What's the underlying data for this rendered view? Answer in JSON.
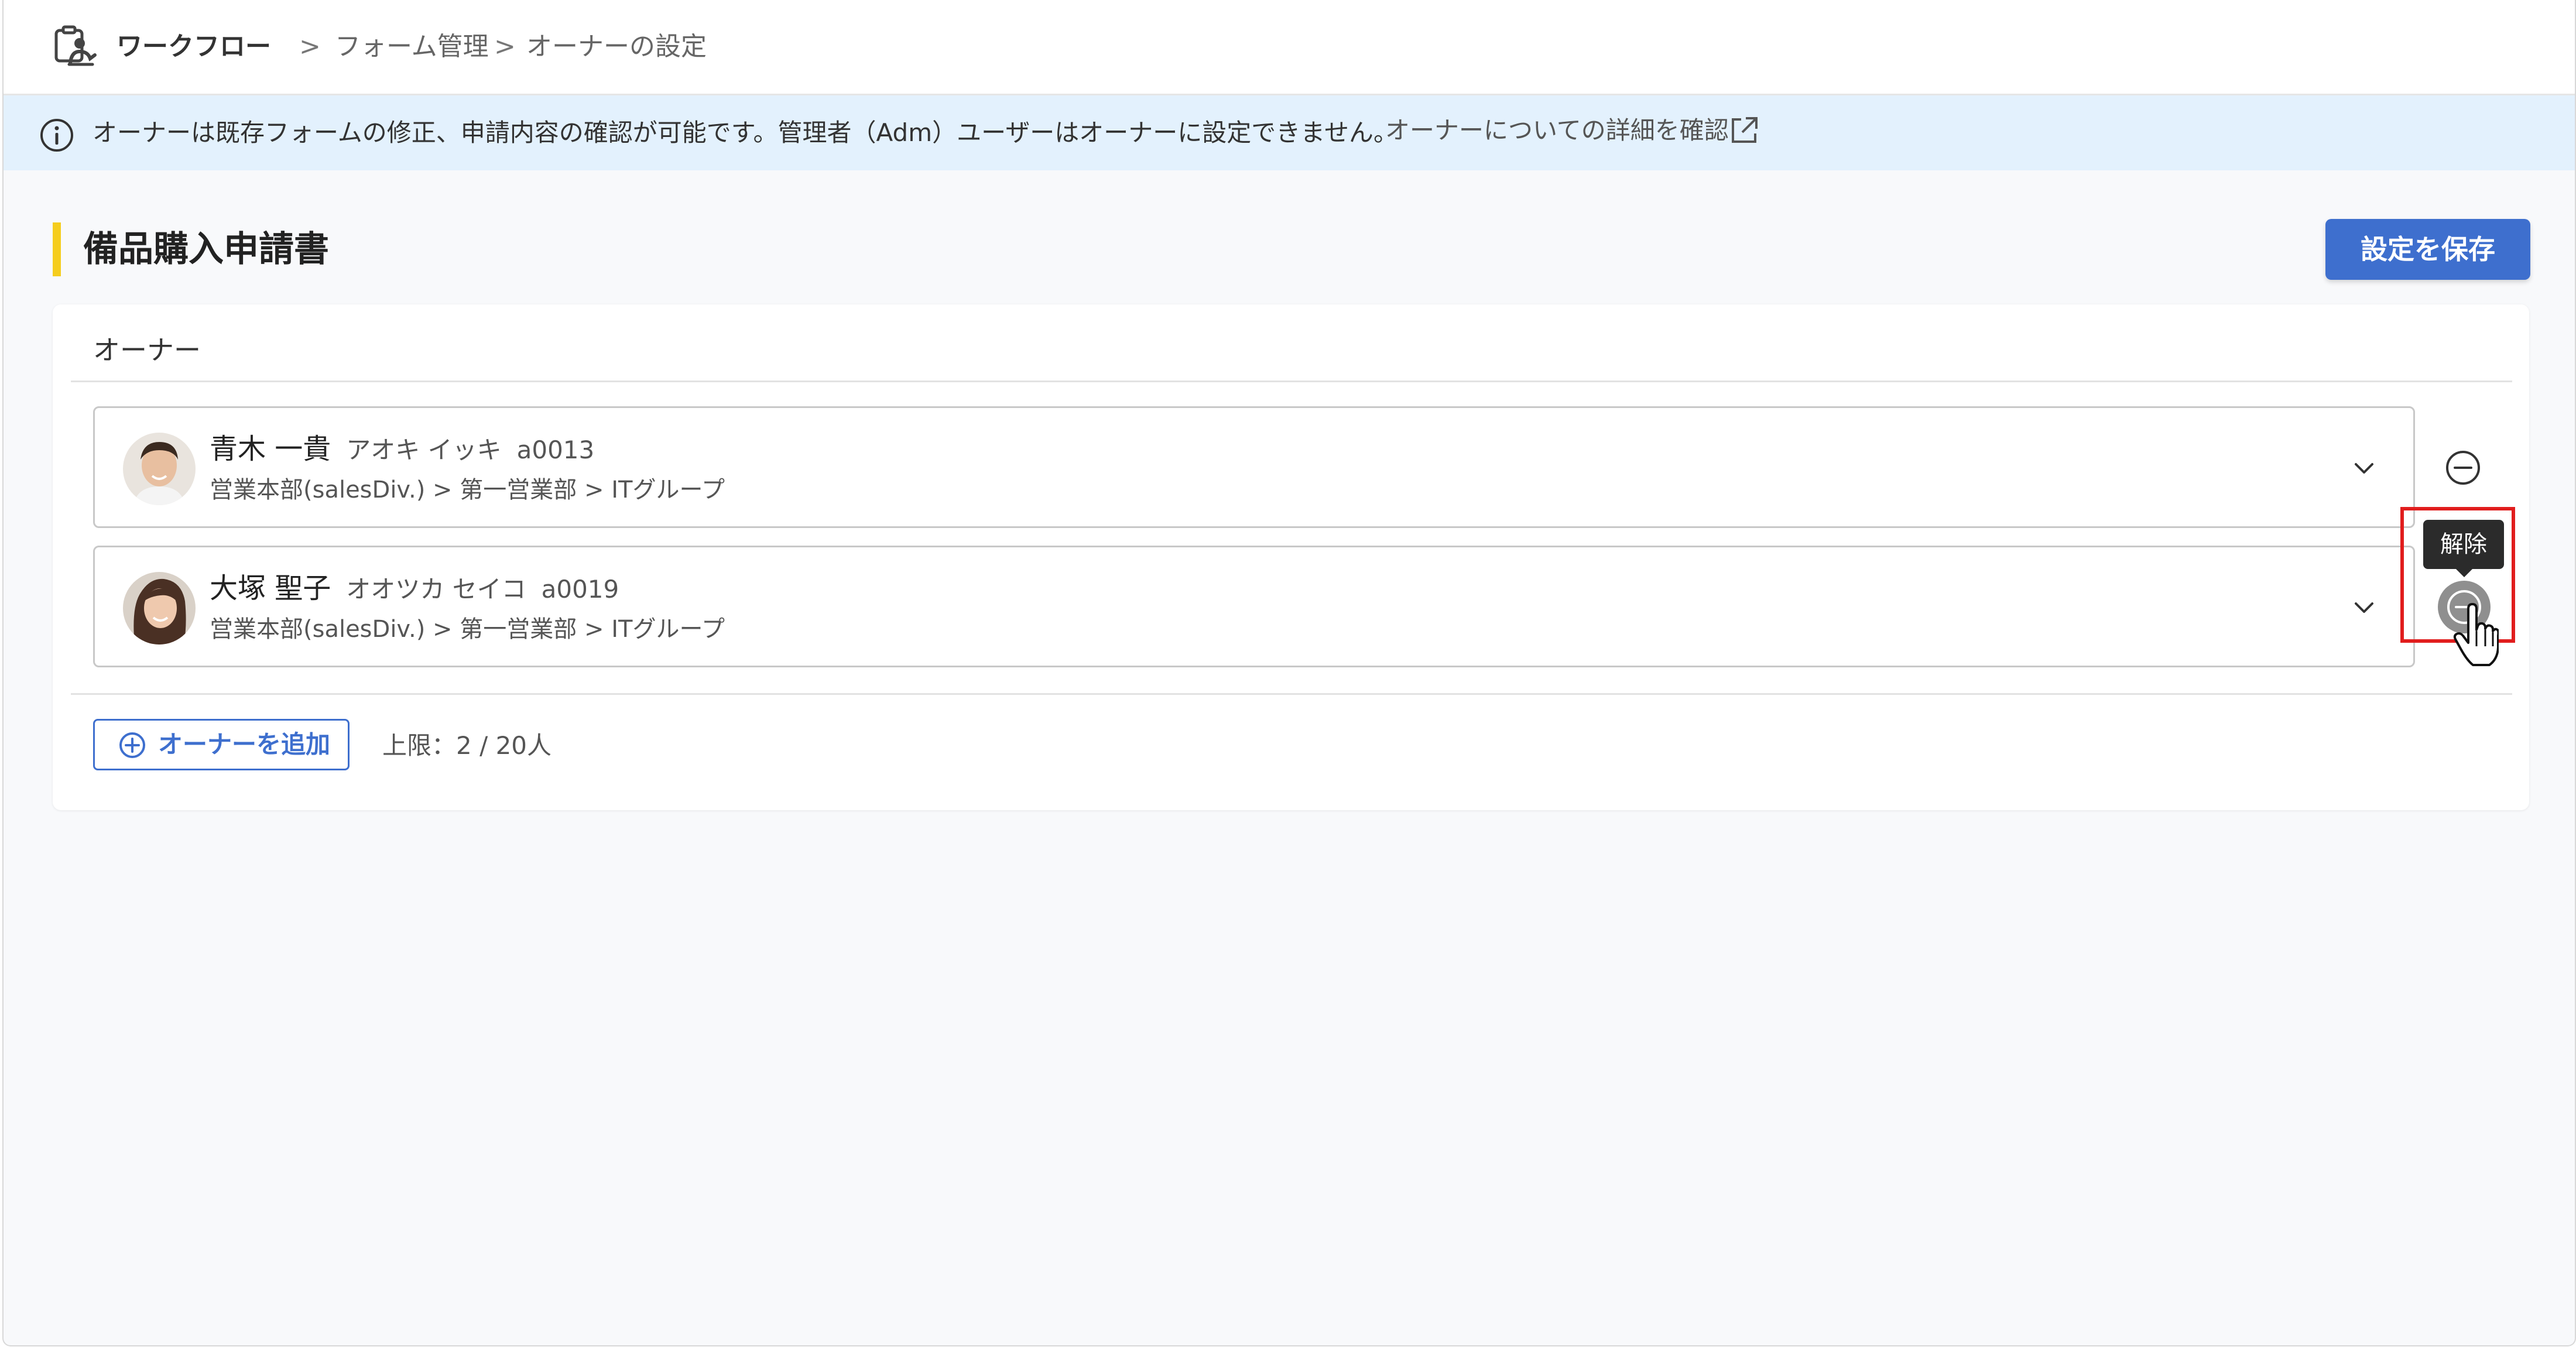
{
  "header": {
    "app_name": "ワークフロー",
    "separator": ">",
    "breadcrumb_forms": "フォーム管理",
    "breadcrumb_current": "オーナーの設定"
  },
  "banner": {
    "text": "オーナーは既存フォームの修正、申請内容の確認が可能です。管理者（Adm）ユーザーはオーナーに設定できません。",
    "link": "オーナーについての詳細を確認"
  },
  "page": {
    "title": "備品購入申請書",
    "save_label": "設定を保存"
  },
  "owners": {
    "section_label": "オーナー",
    "items": [
      {
        "name": "青木 一貴",
        "kana": "アオキ イッキ",
        "id": "a0013",
        "dept": "営業本部(salesDiv.) > 第一営業部 > ITグループ"
      },
      {
        "name": "大塚 聖子",
        "kana": "オオツカ セイコ",
        "id": "a0019",
        "dept": "営業本部(salesDiv.) > 第一営業部 > ITグループ"
      }
    ],
    "remove_tooltip": "解除",
    "add_label": "オーナーを追加",
    "limit_text": "上限：2 / 20人"
  },
  "colors": {
    "accent": "#3e6fce",
    "banner_bg": "#e3f1fd",
    "title_marker": "#f5cd1d",
    "highlight": "#e11d1d"
  },
  "icons": {
    "app": "workflow-icon",
    "info": "info-icon",
    "external": "external-link-icon",
    "chevron": "chevron-down-icon",
    "remove": "minus-circle-icon",
    "add": "plus-circle-icon",
    "cursor": "hand-pointer-icon"
  }
}
